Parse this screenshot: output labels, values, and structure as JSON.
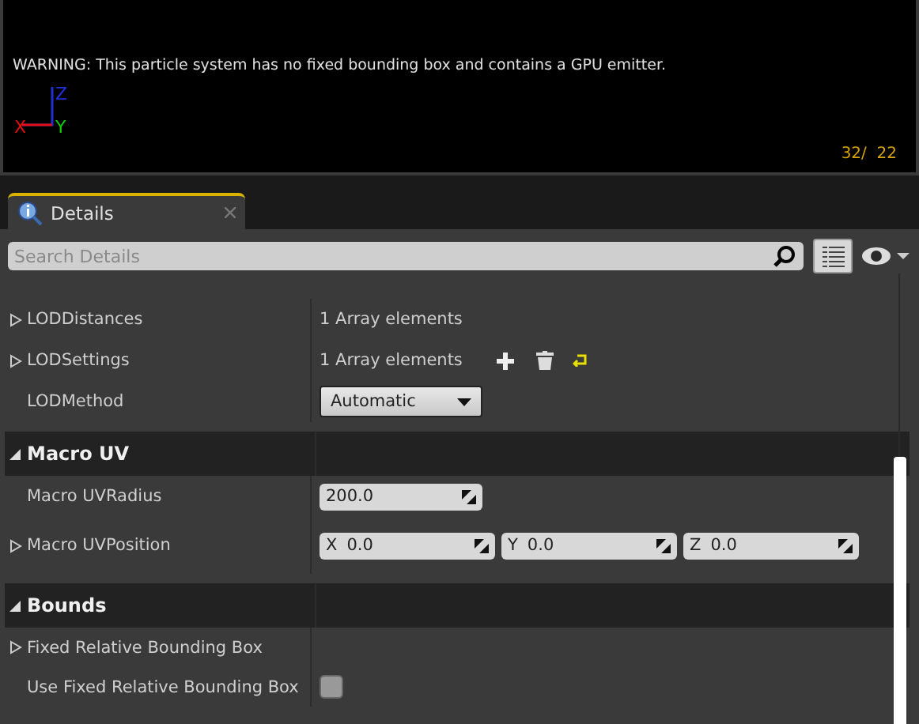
{
  "viewport": {
    "warning": "WARNING: This particle system has no fixed bounding box and contains a GPU emitter.",
    "axes": {
      "x": "X",
      "y": "Y",
      "z": "Z"
    },
    "counter": "32/  22"
  },
  "tabs": [
    {
      "label": "Details",
      "selected": true,
      "closable": true
    }
  ],
  "search": {
    "placeholder": "Search Details"
  },
  "rows": [
    {
      "kind": "array",
      "label": "LODDistances",
      "value": "1 Array elements",
      "expanded": false
    },
    {
      "kind": "array",
      "label": "LODSettings",
      "value": "1 Array elements",
      "expanded": false,
      "show_actions": true
    },
    {
      "kind": "combo",
      "label": "LODMethod",
      "value": "Automatic"
    },
    {
      "kind": "category",
      "label": "Macro UV",
      "expanded": true
    },
    {
      "kind": "number",
      "label": "Macro UVRadius",
      "value": "200.0"
    },
    {
      "kind": "vector",
      "label": "Macro UVPosition",
      "expanded": false,
      "components": [
        {
          "axis": "X",
          "value": "0.0"
        },
        {
          "axis": "Y",
          "value": "0.0"
        },
        {
          "axis": "Z",
          "value": "0.0"
        }
      ]
    },
    {
      "kind": "category",
      "label": "Bounds",
      "expanded": true
    },
    {
      "kind": "struct",
      "label": "Fixed Relative Bounding Box",
      "expanded": false
    },
    {
      "kind": "checkbox",
      "label": "Use Fixed Relative Bounding Box",
      "checked": false
    }
  ]
}
